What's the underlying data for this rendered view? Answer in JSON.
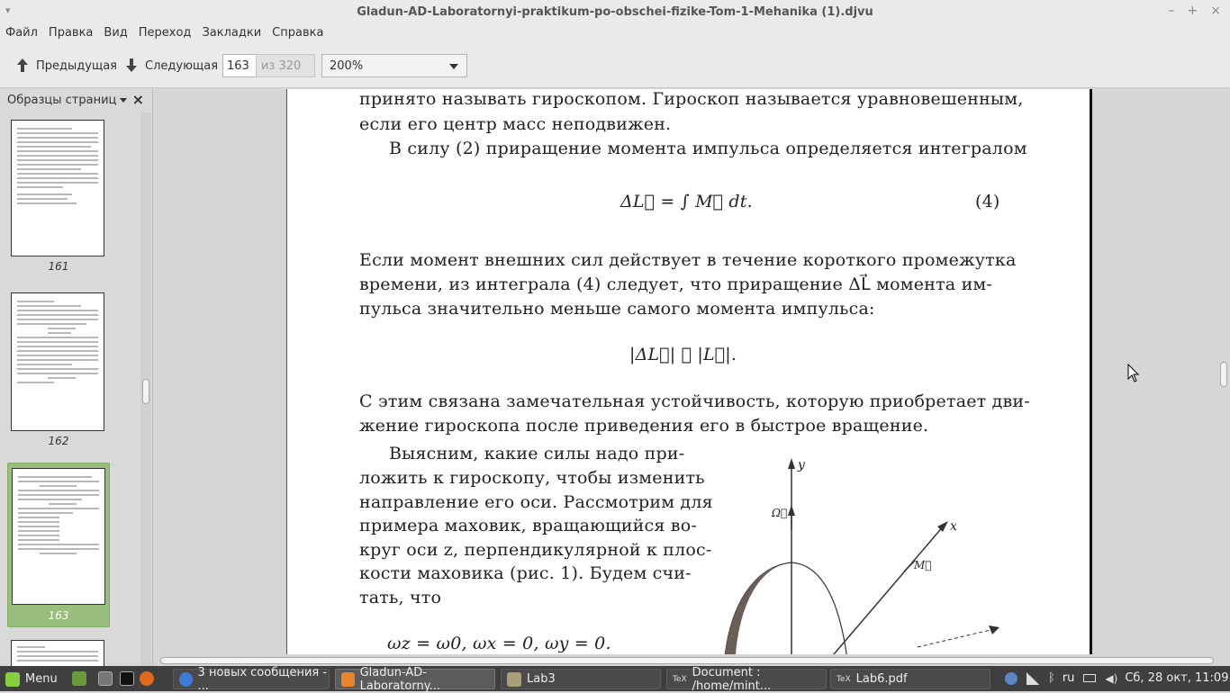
{
  "window": {
    "title": "Gladun-AD-Laboratornyi-praktikum-po-obschei-fizike-Tom-1-Mehanika (1).djvu"
  },
  "menu": [
    "Файл",
    "Правка",
    "Вид",
    "Переход",
    "Закладки",
    "Справка"
  ],
  "toolbar": {
    "prev_label": "Предыдущая",
    "next_label": "Следующая",
    "page_value": "163",
    "page_of": "из 320",
    "zoom": "200%"
  },
  "sidebar": {
    "title": "Образцы страниц",
    "thumbnails": [
      {
        "number": "161",
        "selected": false
      },
      {
        "number": "162",
        "selected": false
      },
      {
        "number": "163",
        "selected": true
      }
    ]
  },
  "document": {
    "lines": [
      "принято называть гироскопом. Гироскоп называется уравновешенным,",
      "если его центр масс неподвижен.",
      "В силу (2) приращение момента импульса определяется интегралом",
      "ΔL⃗ = ∫ M⃗ dt.",
      "(4)",
      "Если момент внешних сил действует в течение короткого промежутка",
      "времени, из интеграла (4) следует, что приращение ΔL⃗ момента им-",
      "пульса значительно меньше самого момента импульса:",
      "|ΔL⃗| ≪ |L⃗|.",
      "С этим связана замечательная устойчивость, которую приобретает дви-",
      "жение гироскопа после приведения его в быстрое вращение.",
      "Выясним, какие силы надо при-",
      "ложить к гироскопу, чтобы изменить",
      "направление его оси. Рассмотрим для",
      "примера маховик, вращающийся во-",
      "круг оси z, перпендикулярной к плос-",
      "кости маховика (рис. 1). Будем счи-",
      "тать, что",
      "ωz = ω0,     ωx = 0,     ωy = 0."
    ],
    "figure_labels": {
      "y": "y",
      "x": "x",
      "omega": "Ω⃗",
      "m": "M⃗"
    }
  },
  "taskbar": {
    "menu_label": "Menu",
    "windows": [
      {
        "label": "3 новых сообщения - ...",
        "active": false
      },
      {
        "label": "Gladun-AD-Laboratorny...",
        "active": true
      },
      {
        "label": "Lab3",
        "active": false
      },
      {
        "label": "Document : /home/mint...",
        "active": false
      },
      {
        "label": "Lab6.pdf",
        "active": false
      }
    ],
    "keyboard_layout": "ru",
    "clock": "Сб, 28 окт, 11:09"
  }
}
